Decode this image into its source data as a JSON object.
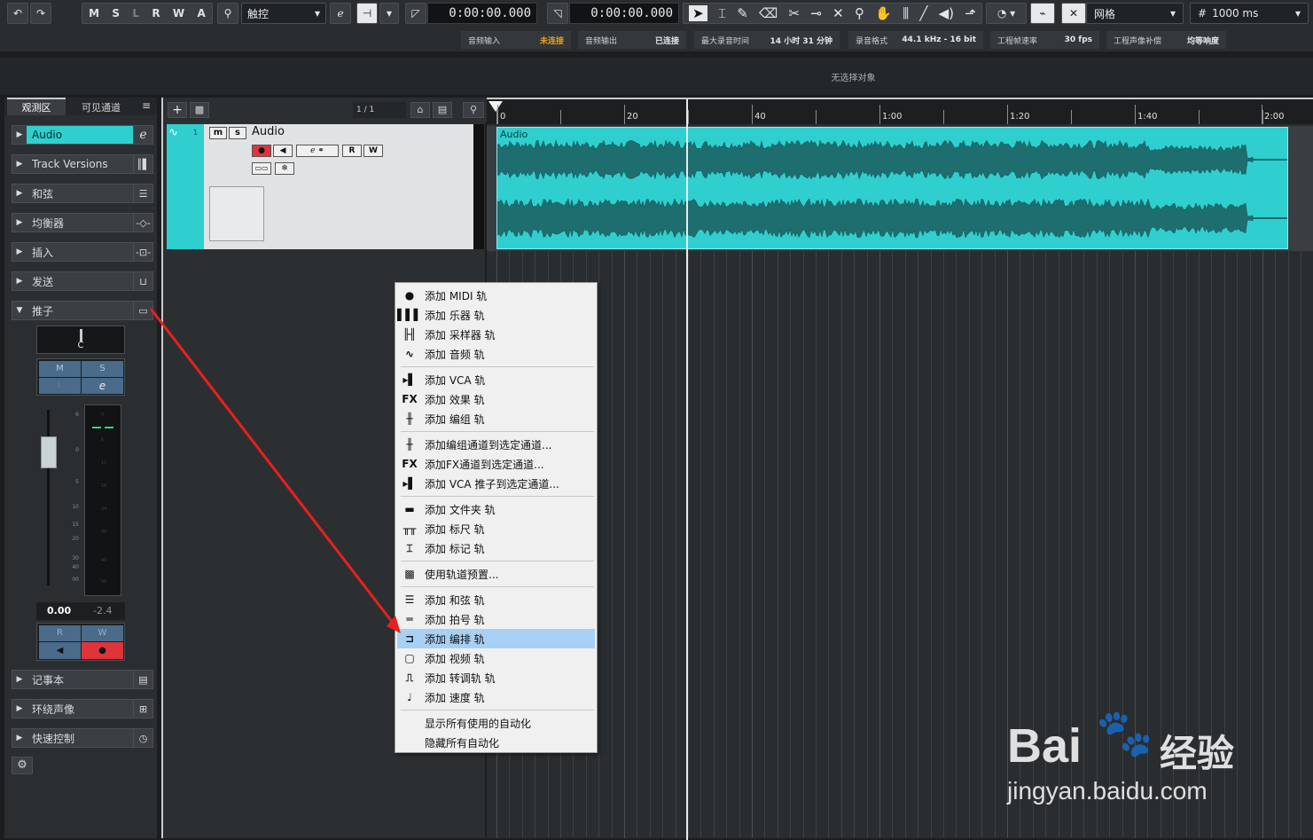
{
  "toolbar": {
    "undo": "↶",
    "redo": "↷",
    "msrwa": [
      "M",
      "S",
      "L",
      "R",
      "W",
      "A"
    ],
    "automation_mode": "触控",
    "time_left": "0:00:00.000",
    "time_right": "0:00:00.000",
    "snap_type": "网格",
    "grid_size": "1000 ms"
  },
  "status": {
    "audio_in_label": "音频输入",
    "audio_in_value": "未连接",
    "audio_out_label": "音频输出",
    "audio_out_value": "已连接",
    "max_rec_label": "最大录音时间",
    "max_rec_value": "14 小时 31 分钟",
    "rec_format_label": "录音格式",
    "rec_format_value": "44.1 kHz - 16 bit",
    "frame_rate_label": "工程帧速率",
    "frame_rate_value": "30 fps",
    "pan_law_label": "工程声像补偿",
    "pan_law_value": "均等响度"
  },
  "info_line": "无选择对象",
  "inspector": {
    "tab_inspector": "观测区",
    "tab_visibility": "可见通道",
    "menu_icon": "≡",
    "sections": [
      {
        "label": "Audio",
        "icon": "e-icon"
      },
      {
        "label": "Track Versions",
        "icon": "versions-icon"
      },
      {
        "label": "和弦",
        "icon": "chord-icon"
      },
      {
        "label": "均衡器",
        "icon": "eq-icon"
      },
      {
        "label": "插入",
        "icon": "insert-icon"
      },
      {
        "label": "发送",
        "icon": "send-icon"
      },
      {
        "label": "推子",
        "icon": "fader-icon"
      }
    ],
    "lower_sections": [
      {
        "label": "记事本",
        "icon": "notepad-icon"
      },
      {
        "label": "环绕声像",
        "icon": "surround-icon"
      },
      {
        "label": "快速控制",
        "icon": "quick-control-icon"
      }
    ],
    "pan_label": "C",
    "btn_m": "M",
    "btn_s": "S",
    "btn_l": "L",
    "btn_e": "e",
    "fader_scale": [
      "6",
      "0",
      "5",
      "10",
      "15",
      "20",
      "30",
      "40",
      "00"
    ],
    "meter_scale": [
      "0",
      "6",
      "12",
      "18",
      "24",
      "30",
      "40",
      "50"
    ],
    "volume": "0.00",
    "peak": "-2.4",
    "btn_r": "R",
    "btn_w": "W"
  },
  "tracklist": {
    "page_counter": "1 / 1",
    "track_number": "1",
    "track_name": "Audio",
    "btn_m": "m",
    "btn_s": "s",
    "btn_r": "R",
    "btn_w": "W"
  },
  "ruler": {
    "labels": [
      "0",
      "20",
      "40",
      "1:00",
      "1:20",
      "1:40",
      "2:00"
    ]
  },
  "event": {
    "name": "Audio",
    "color": "#2fcfcf"
  },
  "context_menu": {
    "items": [
      {
        "icon": "midi-icon",
        "glyph": "●",
        "label": "添加 MIDI 轨"
      },
      {
        "icon": "instrument-icon",
        "glyph": "▌▌▌",
        "label": "添加 乐器 轨"
      },
      {
        "icon": "sampler-icon",
        "glyph": "╟╢",
        "label": "添加 采样器 轨"
      },
      {
        "icon": "audio-icon",
        "glyph": "∿",
        "label": "添加 音频 轨"
      },
      {
        "sep": true
      },
      {
        "icon": "vca-icon",
        "glyph": "▸▌",
        "label": "添加 VCA 轨"
      },
      {
        "icon": "fx-icon",
        "glyph": "FX",
        "label": "添加 效果 轨"
      },
      {
        "icon": "group-icon",
        "glyph": "╫",
        "label": "添加 编组 轨"
      },
      {
        "sep": true
      },
      {
        "icon": "group-icon",
        "glyph": "╫",
        "label": "添加编组通道到选定通道..."
      },
      {
        "icon": "fx-icon",
        "glyph": "FX",
        "label": "添加FX通道到选定通道..."
      },
      {
        "icon": "vca-icon",
        "glyph": "▸▌",
        "label": "添加 VCA 推子到选定通道..."
      },
      {
        "sep": true
      },
      {
        "icon": "folder-icon",
        "glyph": "▬",
        "label": "添加 文件夹 轨"
      },
      {
        "icon": "ruler-icon",
        "glyph": "╥╥",
        "label": "添加 标尺 轨"
      },
      {
        "icon": "marker-icon",
        "glyph": "⌶",
        "label": "添加 标记 轨"
      },
      {
        "sep": true
      },
      {
        "icon": "preset-icon",
        "glyph": "▩",
        "label": "使用轨道预置..."
      },
      {
        "sep": true
      },
      {
        "icon": "chord-icon",
        "glyph": "☰",
        "label": "添加 和弦 轨"
      },
      {
        "icon": "signature-icon",
        "glyph": "═",
        "label": "添加 拍号 轨"
      },
      {
        "icon": "arranger-icon",
        "glyph": "⊐",
        "label": "添加 编排 轨",
        "highlight": true
      },
      {
        "icon": "video-icon",
        "glyph": "▢",
        "label": "添加 视频 轨"
      },
      {
        "icon": "transpose-icon",
        "glyph": "⎍",
        "label": "添加 转调轨 轨"
      },
      {
        "icon": "tempo-icon",
        "glyph": "♩",
        "label": "添加 速度 轨"
      },
      {
        "sep": true
      },
      {
        "icon": "",
        "glyph": "",
        "label": "显示所有使用的自动化"
      },
      {
        "icon": "",
        "glyph": "",
        "label": "隐藏所有自动化"
      }
    ]
  },
  "watermark": {
    "brand": "Bai",
    "brand2": "经验",
    "url": "jingyan.baidu.com"
  },
  "colors": {
    "accent": "#2fcfcf",
    "record_red": "#e0343c",
    "annotation_arrow": "#e8201c",
    "menu_highlight": "#a8d0f4"
  }
}
